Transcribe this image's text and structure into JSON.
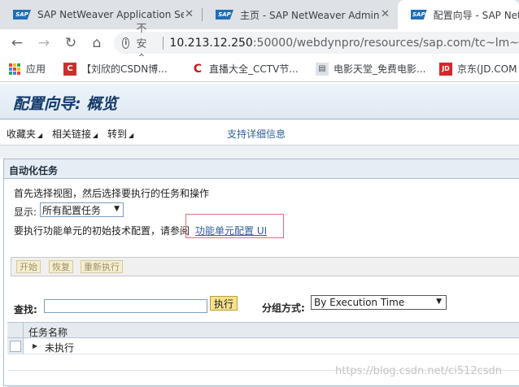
{
  "browser": {
    "tabs": [
      {
        "title": "SAP NetWeaver Application Se",
        "favicon": "SAP",
        "active": false
      },
      {
        "title": "主页 - SAP NetWeaver Adminis",
        "favicon": "SAP",
        "active": false
      },
      {
        "title": "配置向导 - SAP NetWe",
        "favicon": "SAP",
        "active": true
      }
    ],
    "close_glyph": "✕",
    "address": {
      "security_label": "不安全",
      "host": "10.213.12.250",
      "path": ":50000/webdynpro/resources/sap.com/tc~lm~"
    },
    "bookmarks": [
      {
        "label": "应用",
        "icon": "apps-grid-icon"
      },
      {
        "label": "【刘欣的CSDN博...",
        "icon": "csdn-icon"
      },
      {
        "label": "直播大全_CCTV节...",
        "icon": "cctv-icon"
      },
      {
        "label": "电影天堂_免费电影...",
        "icon": "film-icon"
      },
      {
        "label": "京东(JD.COM",
        "icon": "jd-icon"
      }
    ]
  },
  "sap": {
    "page_title": "配置向导: 概览",
    "menu": [
      {
        "label": "收藏夹"
      },
      {
        "label": "相关链接"
      },
      {
        "label": "转到"
      }
    ],
    "support_link": "支持详细信息",
    "panel_title": "自动化任务",
    "intro": "首先选择视图，然后选择要执行的任务和操作",
    "show_label": "显示:",
    "show_value": "所有配置任务",
    "ref_text": "要执行功能单元的初始技术配置，请参阅",
    "ref_link": "功能单元配置 UI",
    "toolbar_buttons": [
      {
        "label": "开始"
      },
      {
        "label": "恢复"
      },
      {
        "label": "重新执行"
      }
    ],
    "find_label": "查找:",
    "find_value": "",
    "execute_label": "执行",
    "group_label": "分组方式:",
    "group_value": "By Execution Time",
    "grid_header": "任务名称",
    "grid_rows": [
      {
        "label": "未执行"
      }
    ]
  },
  "watermark": "https://blog.csdn.net/ci512csdn"
}
